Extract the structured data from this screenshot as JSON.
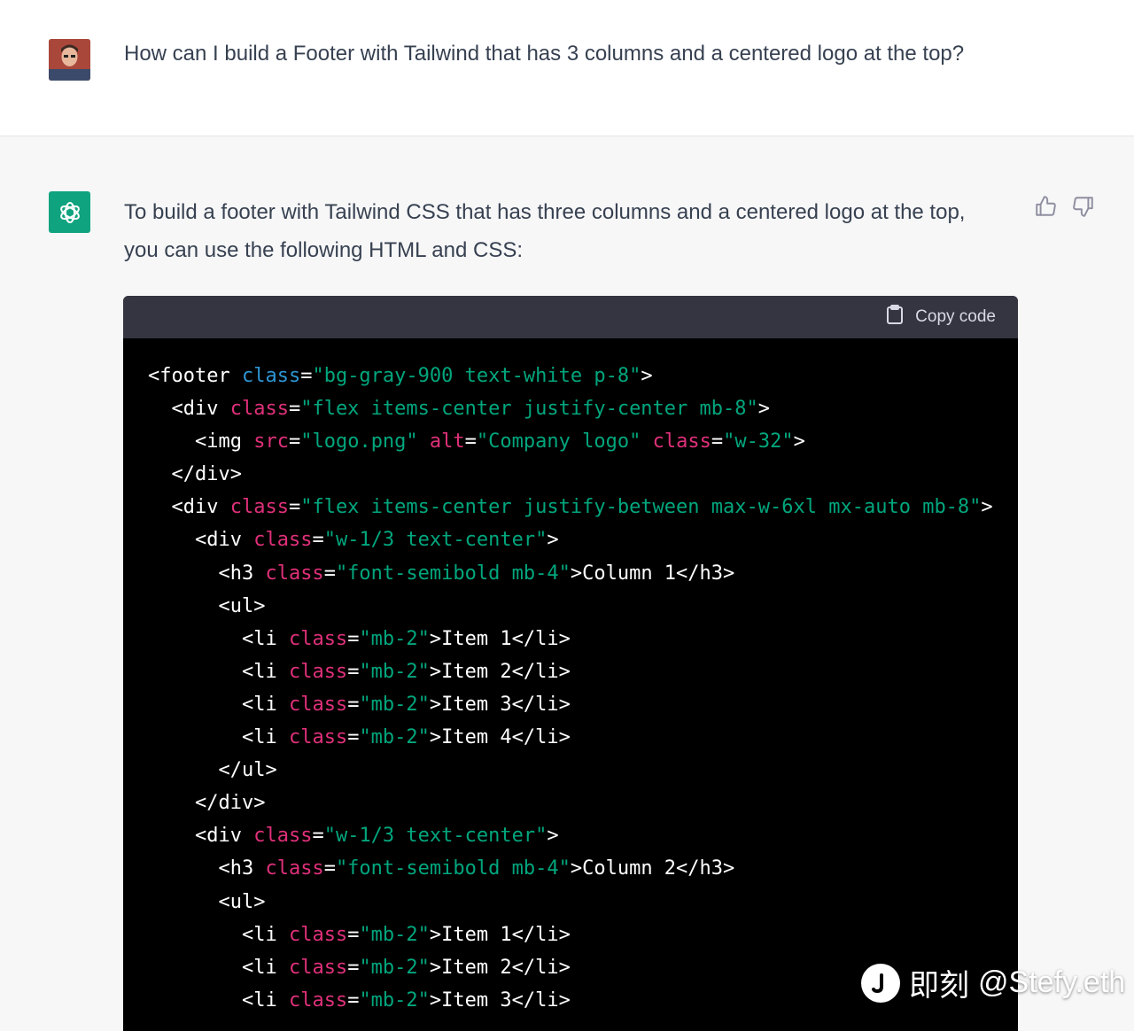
{
  "user": {
    "message": "How can I build a Footer with Tailwind that has 3 columns and a centered logo at the top?"
  },
  "assistant": {
    "intro_line1": "To build a footer with Tailwind CSS that has three columns and a centered logo at the top,",
    "intro_line2": "you can use the following HTML and CSS:",
    "copy_label": "Copy code",
    "code_lines": [
      [
        [
          "tag",
          "<footer "
        ],
        [
          "attr alt",
          "class"
        ],
        [
          "tag",
          "="
        ],
        [
          "str",
          "\"bg-gray-900 text-white p-8\""
        ],
        [
          "tag",
          ">"
        ]
      ],
      [
        [
          "tag",
          "  <div "
        ],
        [
          "attr",
          "class"
        ],
        [
          "tag",
          "="
        ],
        [
          "str",
          "\"flex items-center justify-center mb-8\""
        ],
        [
          "tag",
          ">"
        ]
      ],
      [
        [
          "tag",
          "    <img "
        ],
        [
          "attr",
          "src"
        ],
        [
          "tag",
          "="
        ],
        [
          "str",
          "\"logo.png\""
        ],
        [
          "tag",
          " "
        ],
        [
          "attr",
          "alt"
        ],
        [
          "tag",
          "="
        ],
        [
          "str",
          "\"Company logo\""
        ],
        [
          "tag",
          " "
        ],
        [
          "attr",
          "class"
        ],
        [
          "tag",
          "="
        ],
        [
          "str",
          "\"w-32\""
        ],
        [
          "tag",
          ">"
        ]
      ],
      [
        [
          "tag",
          "  </div>"
        ]
      ],
      [
        [
          "tag",
          "  <div "
        ],
        [
          "attr",
          "class"
        ],
        [
          "tag",
          "="
        ],
        [
          "str",
          "\"flex items-center justify-between max-w-6xl mx-auto mb-8\""
        ],
        [
          "tag",
          ">"
        ]
      ],
      [
        [
          "tag",
          "    <div "
        ],
        [
          "attr",
          "class"
        ],
        [
          "tag",
          "="
        ],
        [
          "str",
          "\"w-1/3 text-center\""
        ],
        [
          "tag",
          ">"
        ]
      ],
      [
        [
          "tag",
          "      <h3 "
        ],
        [
          "attr",
          "class"
        ],
        [
          "tag",
          "="
        ],
        [
          "str",
          "\"font-semibold mb-4\""
        ],
        [
          "tag",
          ">Column 1</h3>"
        ]
      ],
      [
        [
          "tag",
          "      <ul>"
        ]
      ],
      [
        [
          "tag",
          "        <li "
        ],
        [
          "attr",
          "class"
        ],
        [
          "tag",
          "="
        ],
        [
          "str",
          "\"mb-2\""
        ],
        [
          "tag",
          ">Item 1</li>"
        ]
      ],
      [
        [
          "tag",
          "        <li "
        ],
        [
          "attr",
          "class"
        ],
        [
          "tag",
          "="
        ],
        [
          "str",
          "\"mb-2\""
        ],
        [
          "tag",
          ">Item 2</li>"
        ]
      ],
      [
        [
          "tag",
          "        <li "
        ],
        [
          "attr",
          "class"
        ],
        [
          "tag",
          "="
        ],
        [
          "str",
          "\"mb-2\""
        ],
        [
          "tag",
          ">Item 3</li>"
        ]
      ],
      [
        [
          "tag",
          "        <li "
        ],
        [
          "attr",
          "class"
        ],
        [
          "tag",
          "="
        ],
        [
          "str",
          "\"mb-2\""
        ],
        [
          "tag",
          ">Item 4</li>"
        ]
      ],
      [
        [
          "tag",
          "      </ul>"
        ]
      ],
      [
        [
          "tag",
          "    </div>"
        ]
      ],
      [
        [
          "tag",
          "    <div "
        ],
        [
          "attr",
          "class"
        ],
        [
          "tag",
          "="
        ],
        [
          "str",
          "\"w-1/3 text-center\""
        ],
        [
          "tag",
          ">"
        ]
      ],
      [
        [
          "tag",
          "      <h3 "
        ],
        [
          "attr",
          "class"
        ],
        [
          "tag",
          "="
        ],
        [
          "str",
          "\"font-semibold mb-4\""
        ],
        [
          "tag",
          ">Column 2</h3>"
        ]
      ],
      [
        [
          "tag",
          "      <ul>"
        ]
      ],
      [
        [
          "tag",
          "        <li "
        ],
        [
          "attr",
          "class"
        ],
        [
          "tag",
          "="
        ],
        [
          "str",
          "\"mb-2\""
        ],
        [
          "tag",
          ">Item 1</li>"
        ]
      ],
      [
        [
          "tag",
          "        <li "
        ],
        [
          "attr",
          "class"
        ],
        [
          "tag",
          "="
        ],
        [
          "str",
          "\"mb-2\""
        ],
        [
          "tag",
          ">Item 2</li>"
        ]
      ],
      [
        [
          "tag",
          "        <li "
        ],
        [
          "attr",
          "class"
        ],
        [
          "tag",
          "="
        ],
        [
          "str",
          "\"mb-2\""
        ],
        [
          "tag",
          ">Item 3</li>"
        ]
      ]
    ]
  },
  "watermark": {
    "brand": "即刻",
    "handle": "@Stefy.eth"
  },
  "colors": {
    "accent": "#10a37f",
    "code_bg": "#000000",
    "code_header_bg": "#343541",
    "syntax_attr": "#df3079",
    "syntax_attr_alt": "#2e95d3",
    "syntax_string": "#00a67d"
  },
  "icons": [
    "user-avatar",
    "openai-logo-icon",
    "thumbs-up-icon",
    "thumbs-down-icon",
    "clipboard-icon",
    "jike-logo-icon"
  ]
}
